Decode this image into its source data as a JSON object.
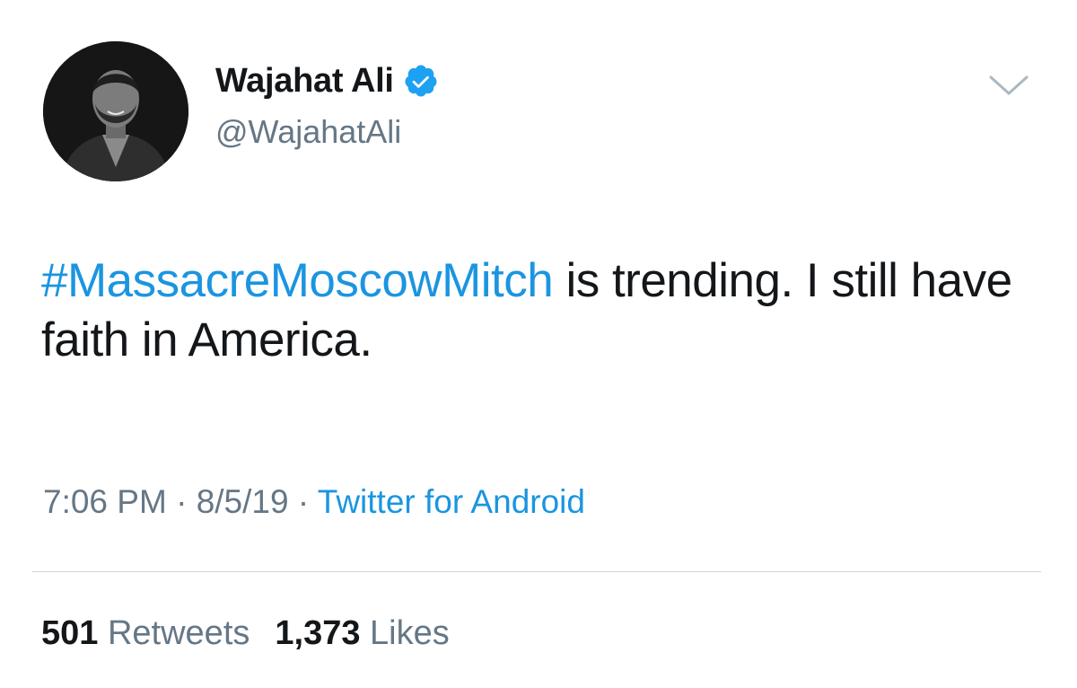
{
  "author": {
    "display_name": "Wajahat Ali",
    "handle": "@WajahatAli",
    "verified_icon": "verified-badge-icon"
  },
  "tweet": {
    "hashtag": "#MassacreMoscowMitch",
    "text": " is trending. I still have faith in America."
  },
  "meta": {
    "time": "7:06 PM",
    "separator_1": " · ",
    "date": "8/5/19",
    "separator_2": " · ",
    "source": "Twitter for Android"
  },
  "stats": {
    "retweets_count": "501",
    "retweets_label": "Retweets",
    "likes_count": "1,373",
    "likes_label": "Likes"
  },
  "colors": {
    "link_blue": "#1b95e0",
    "secondary_gray": "#657786",
    "primary_text": "#14171a",
    "verified_blue": "#1da1f2"
  }
}
